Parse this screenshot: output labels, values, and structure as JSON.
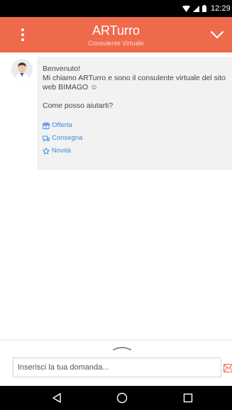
{
  "status_bar": {
    "time": "12:29"
  },
  "header": {
    "title": "ARTurro",
    "subtitle": "Consulente Virtuale",
    "background": "#ef6a4a"
  },
  "message": {
    "lines": [
      "Benvenuto!",
      "Mi chiamo ARTurro e sono il consulente virtuale del sito web BIMAGO ☺"
    ],
    "question": "Come posso aiutarti?",
    "options": [
      {
        "label": "Offerta",
        "icon": "gift-icon"
      },
      {
        "label": "Consegna",
        "icon": "truck-icon"
      },
      {
        "label": "Novità",
        "icon": "star-icon"
      }
    ]
  },
  "input": {
    "placeholder": "Inserisci la tua domanda..."
  },
  "nav": {
    "icons": [
      "back-icon",
      "home-icon",
      "recent-apps-icon"
    ]
  }
}
